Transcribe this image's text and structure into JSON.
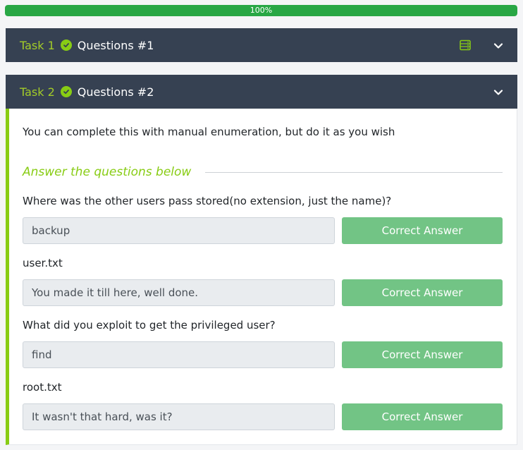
{
  "progress": {
    "label": "100%",
    "value": 1.0
  },
  "tasks": [
    {
      "number": "Task 1",
      "title": "Questions #1",
      "completed": true
    },
    {
      "number": "Task 2",
      "title": "Questions #2",
      "completed": true
    }
  ],
  "task2": {
    "intro": "You can complete this with manual enumeration, but do it as you wish",
    "section_heading": "Answer the questions below",
    "questions": [
      {
        "prompt": "Where was the other users pass stored(no extension, just the name)?",
        "answer": "backup",
        "button": "Correct Answer"
      },
      {
        "prompt": "user.txt",
        "answer": "You made it till here, well done.",
        "button": "Correct Answer"
      },
      {
        "prompt": "What did you exploit to get the privileged user?",
        "answer": "find",
        "button": "Correct Answer"
      },
      {
        "prompt": "root.txt",
        "answer": "It wasn't that hard, was it?",
        "button": "Correct Answer"
      }
    ]
  },
  "colors": {
    "progress_fill": "#28a745",
    "header_bg": "#364152",
    "accent_green": "#88cc14",
    "task_number": "#a3cc28",
    "correct_button": "#72c485"
  },
  "icons": [
    "check-circle-icon",
    "server-icon",
    "chevron-down-icon"
  ]
}
